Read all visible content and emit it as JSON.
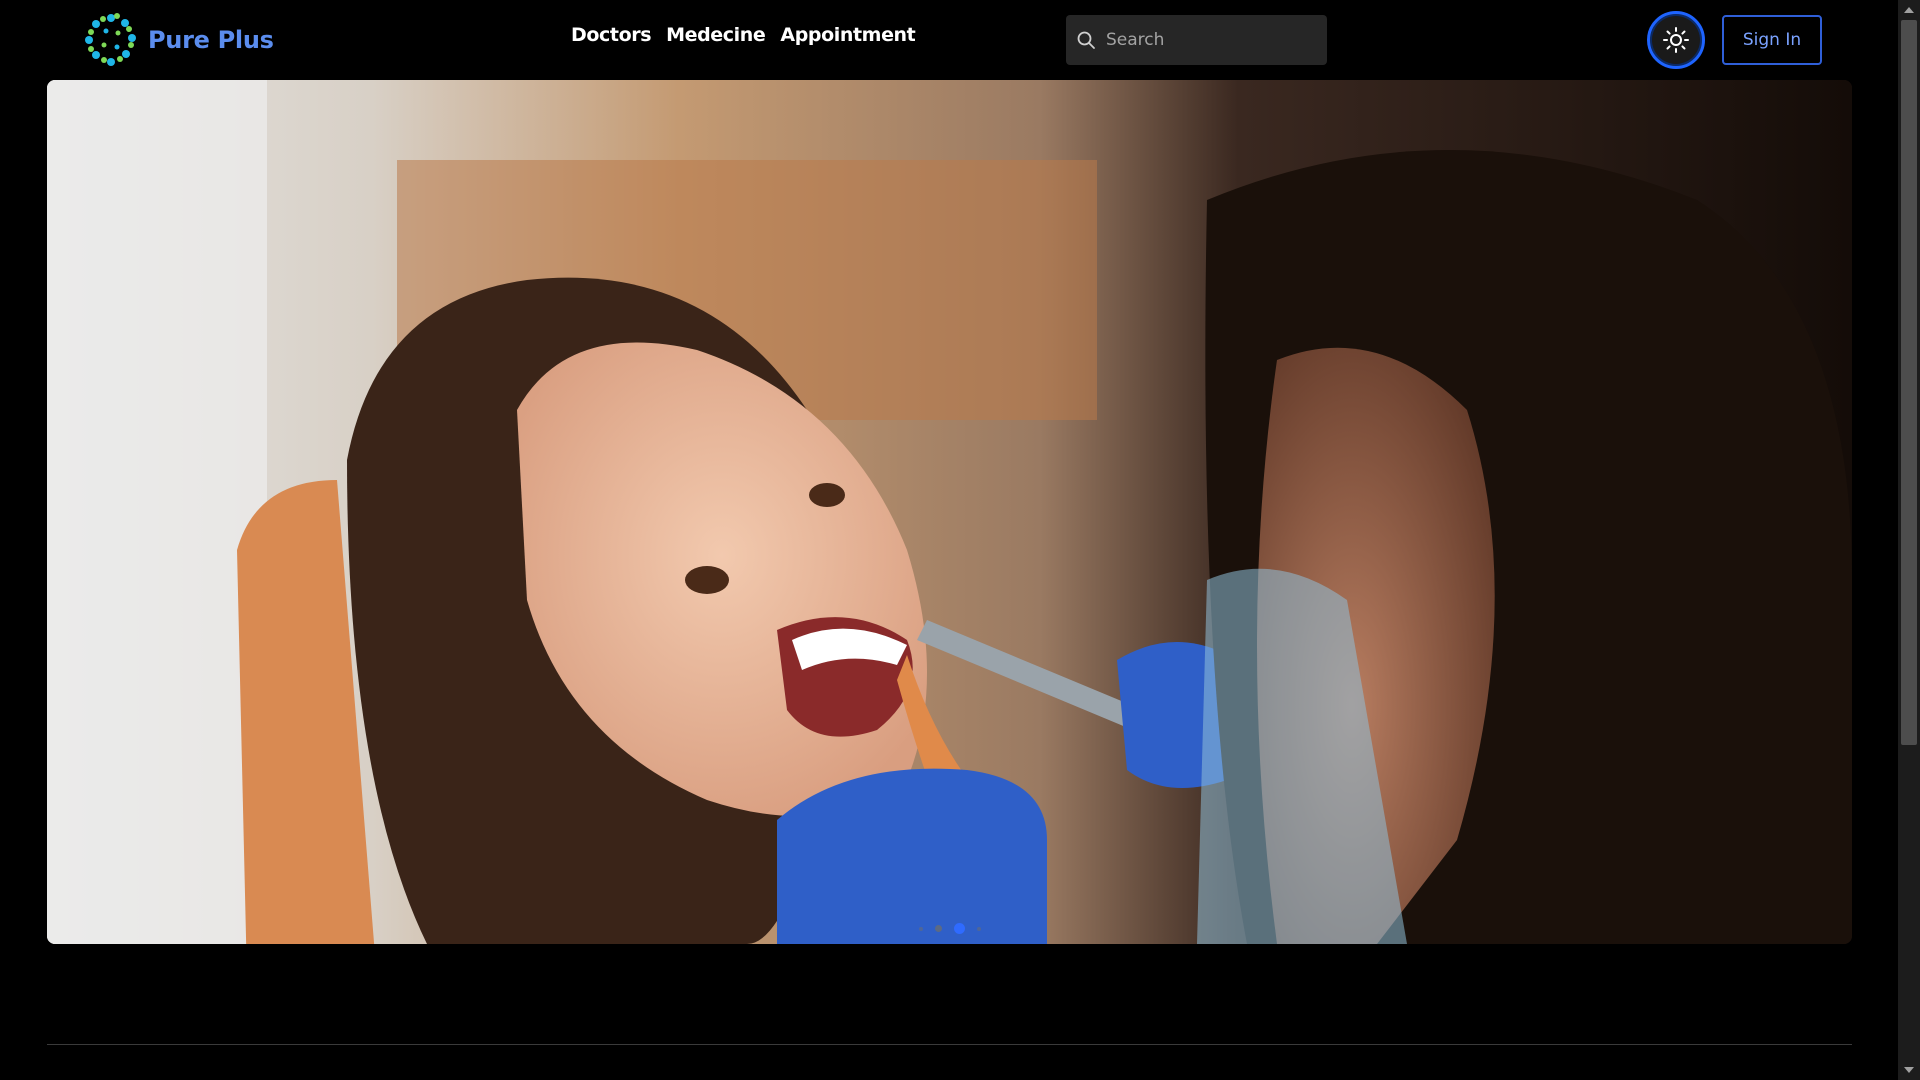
{
  "brand": {
    "name": "Pure Plus",
    "color": "#5b8dee"
  },
  "nav": {
    "items": [
      {
        "label": "Doctors"
      },
      {
        "label": "Medecine"
      },
      {
        "label": "Appointment"
      }
    ]
  },
  "search": {
    "placeholder": "Search",
    "value": ""
  },
  "header": {
    "theme_toggle_icon": "sun-icon",
    "signin_label": "Sign In",
    "accent": "#1e64ff"
  },
  "carousel": {
    "image_alt": "Smiling woman in a dental chair while a dentist with blue gloves works on her teeth",
    "slide_count": 4,
    "active_slide": 3
  },
  "scrollbar": {
    "up_icon": "triangle-up-icon",
    "down_icon": "triangle-down-icon"
  }
}
